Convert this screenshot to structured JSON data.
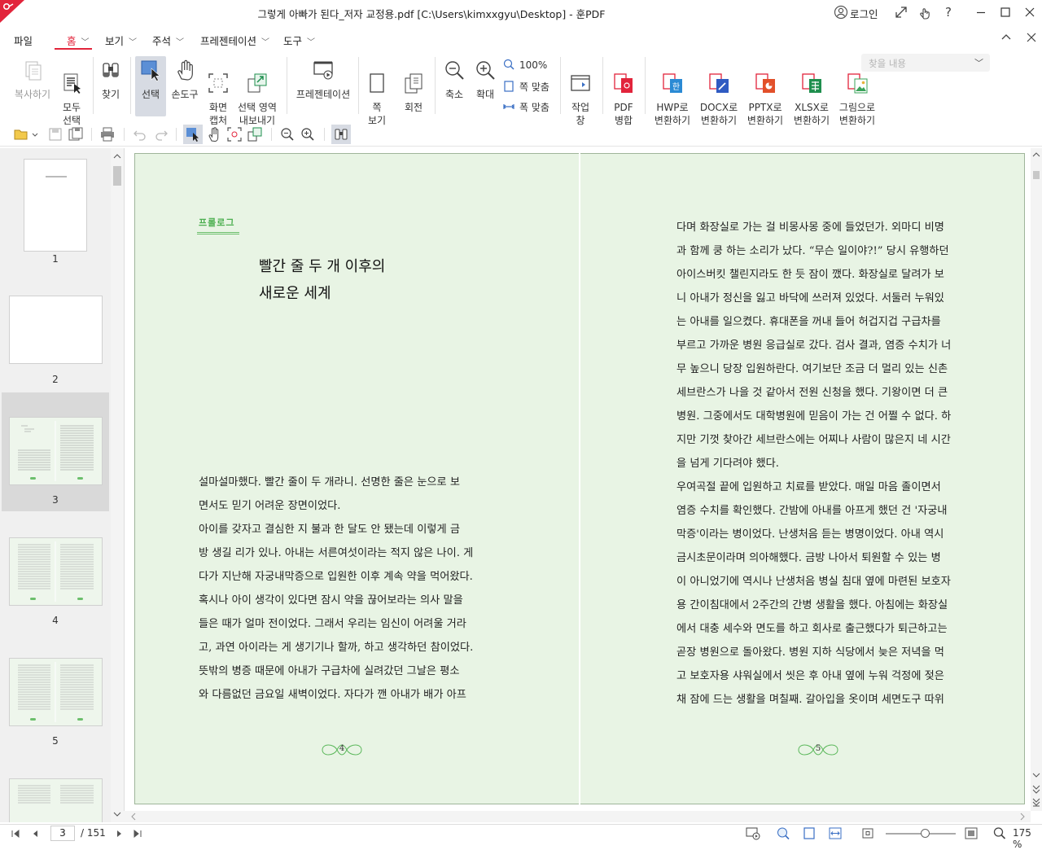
{
  "titlebar": {
    "title": "그렇게 아빠가 된다_저자 교정용.pdf [C:\\Users\\kimxxgyu\\Desktop] - 훈PDF",
    "login_label": "로그인"
  },
  "menu": {
    "file": "파일",
    "tabs": [
      {
        "label": "홈"
      },
      {
        "label": "보기"
      },
      {
        "label": "주석"
      },
      {
        "label": "프레젠테이션"
      },
      {
        "label": "도구"
      }
    ],
    "search_placeholder": "찾을 내용"
  },
  "ribbon": {
    "copy": "복사하기",
    "select_all": "모두\n선택",
    "find": "찾기",
    "select": "선택",
    "hand": "손도구",
    "capture": "화면\n캡처",
    "export_area": "선택 영역\n내보내기",
    "presentation": "프레젠테이션",
    "page_view": "쪽\n보기",
    "rotate": "회전",
    "zoom_out": "축소",
    "zoom_in": "확대",
    "zoom_100": "100%",
    "fit_page": "쪽 맞춤",
    "fit_width": "폭 맞춤",
    "task_window": "작업\n창",
    "pdf_merge": "PDF\n병합",
    "to_hwp": "HWP로\n변환하기",
    "to_docx": "DOCX로\n변환하기",
    "to_pptx": "PPTX로\n변환하기",
    "to_xlsx": "XLSX로\n변환하기",
    "to_image": "그림으로\n변환하기",
    "colors": {
      "accent": "#e2243b",
      "hwp": "#2a8ad4",
      "docx": "#2f5bc2",
      "pptx": "#e2502a",
      "xlsx": "#1f8f4e",
      "image": "#3aa35a"
    }
  },
  "thumbnails": {
    "pages": [
      {
        "num": "1"
      },
      {
        "num": "2"
      },
      {
        "num": "3"
      },
      {
        "num": "4"
      },
      {
        "num": "5"
      }
    ],
    "selected": "3"
  },
  "document": {
    "left": {
      "chapter_label": "프롤로그",
      "title_line1": "빨간 줄 두 개 이후의",
      "title_line2": "새로운 세계",
      "lines": [
        "  설마설마했다. 빨간 줄이 두 개라니. 선명한 줄은 눈으로 보",
        "면서도 믿기 어려운 장면이었다.",
        "  아이를 갖자고 결심한 지 불과 한 달도 안 됐는데 이렇게 금",
        "방 생길 리가 있나. 아내는 서른여섯이라는 적지 않은 나이. 게",
        "다가 지난해 자궁내막증으로 입원한 이후 계속 약을 먹어왔다.",
        "혹시나 아이 생각이 있다면 잠시 약을 끊어보라는 의사 말을",
        "들은 때가 얼마 전이었다. 그래서 우리는 임신이 어려울 거라",
        "고, 과연 아이라는 게 생기기나 할까, 하고 생각하던 참이었다.",
        "  뜻밖의 병증 때문에 아내가 구급차에 실려갔던 그날은 평소",
        "와 다름없던 금요일 새벽이었다. 자다가 깬 아내가 배가 아프"
      ],
      "page_num": "4"
    },
    "right": {
      "lines": [
        "다며 화장실로 가는 걸 비몽사몽 중에 들었던가. 외마디 비명",
        "과 함께 쿵 하는 소리가 났다. “무슨 일이야?!” 당시 유행하던",
        "아이스버킷 챌린지라도 한 듯 잠이 깼다. 화장실로 달려가 보",
        "니 아내가 정신을 잃고 바닥에 쓰러져 있었다. 서둘러 누워있",
        "는 아내를 일으켰다. 휴대폰을 꺼내 들어 허겁지겁 구급차를",
        "부르고 가까운 병원 응급실로 갔다. 검사 결과, 염증 수치가 너",
        "무 높으니 당장 입원하란다. 여기보단 조금 더 멀리 있는 신촌",
        "세브란스가 나을 것 같아서 전원 신청을 했다. 기왕이면 더 큰",
        "병원. 그중에서도 대학병원에 믿음이 가는 건 어쩔 수 없다. 하",
        "지만 기껏 찾아간 세브란스에는 어찌나 사람이 많은지 네 시간",
        "을 넘게 기다려야 했다.",
        "  우여곡절 끝에 입원하고 치료를 받았다. 매일 마음 졸이면서",
        "염증 수치를 확인했다. 간밤에 아내를 아프게 했던 건 '자궁내",
        "막증'이라는 병이었다. 난생처음 듣는 병명이었다. 아내 역시",
        "금시초문이라며 의아해했다. 금방 나아서 퇴원할 수 있는 병",
        "이 아니었기에 역시나 난생처음 병실 침대 옆에 마련된 보호자",
        "용 간이침대에서 2주간의 간병 생활을 했다. 아침에는 화장실",
        "에서 대충 세수와 면도를 하고 회사로 출근했다가 퇴근하고는",
        "곧장 병원으로 돌아왔다. 병원 지하 식당에서 늦은 저녁을 먹",
        "고 보호자용 샤워실에서 씻은 후 아내 옆에 누워 걱정에 젖은",
        "채 잠에 드는 생활을 며칠째. 갈아입을 옷이며 세면도구 따위"
      ],
      "page_num": "5"
    }
  },
  "statusbar": {
    "current_page": "3",
    "total_pages": "/ 151",
    "zoom": "175 %",
    "zoom_level": 1.75
  }
}
